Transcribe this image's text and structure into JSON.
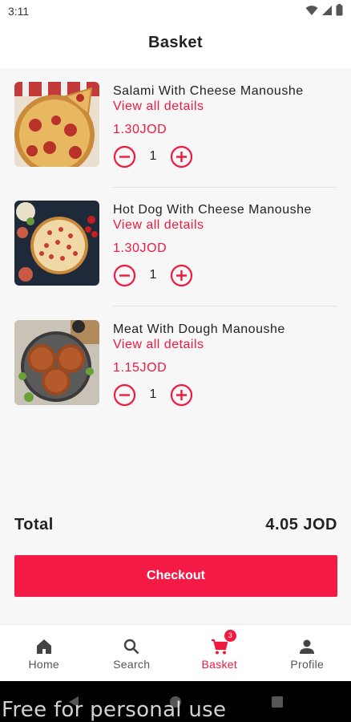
{
  "status_bar": {
    "time": "3:11"
  },
  "header": {
    "title": "Basket"
  },
  "items": [
    {
      "name": "Salami With Cheese Manoushe",
      "details_label": "View all details",
      "price": "1.30JOD",
      "quantity": "1",
      "image": "salami-pizza-image"
    },
    {
      "name": "Hot Dog With Cheese Manoushe",
      "details_label": "View all details",
      "price": "1.30JOD",
      "quantity": "1",
      "image": "hotdog-pizza-image"
    },
    {
      "name": "Meat With Dough Manoushe",
      "details_label": "View all details",
      "price": "1.15JOD",
      "quantity": "1",
      "image": "meat-manoushe-image"
    }
  ],
  "summary": {
    "total_label": "Total",
    "total_value": "4.05 JOD"
  },
  "checkout": {
    "label": "Checkout"
  },
  "bottom_nav": {
    "items": [
      {
        "label": "Home",
        "icon": "home-icon"
      },
      {
        "label": "Search",
        "icon": "search-icon"
      },
      {
        "label": "Basket",
        "icon": "cart-icon",
        "badge": "3",
        "active": true
      },
      {
        "label": "Profile",
        "icon": "person-icon"
      }
    ]
  },
  "watermark": {
    "text": "Free for personal use"
  },
  "colors": {
    "accent": "#f0193f",
    "checkout_button": "#f31b45",
    "background": "#f7f7f7"
  }
}
